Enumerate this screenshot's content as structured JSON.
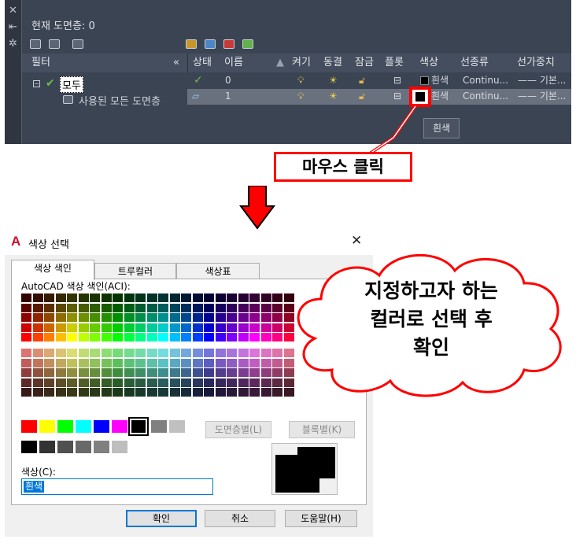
{
  "layer_manager": {
    "side_icons": [
      "✕",
      "⇤",
      "✲"
    ],
    "current_layer": "현재 도면층: 0",
    "filter_header": "필터",
    "collapse_glyph": "«",
    "columns": [
      "상태",
      "이름",
      "켜기",
      "동결",
      "잠금",
      "플롯",
      "색상",
      "선종류",
      "선가중치"
    ],
    "tree": {
      "root": "모두",
      "child": "사용된 모든 도면층"
    },
    "rows": [
      {
        "name": "0",
        "color": "흰색",
        "linetype": "Continu...",
        "lineweight": "—— 기본..."
      },
      {
        "name": "1",
        "color": "흰색",
        "linetype": "Continu...",
        "lineweight": "—— 기본..."
      }
    ],
    "tooltip": "흰색"
  },
  "callout_click": "마우스 클릭",
  "dialog": {
    "title": "색상 선택",
    "close_glyph": "✕",
    "tabs": [
      "색상 색인",
      "트루컬러",
      "색상표"
    ],
    "aci_label": "AutoCAD 색상 색인(ACI):",
    "bylayer_label": "도면층별(L)",
    "byblock_label": "블록별(K)",
    "color_label": "색상(C):",
    "color_value": "흰색",
    "ok_label": "확인",
    "cancel_label": "취소",
    "help_label": "도움말(H)"
  },
  "cloud_text": [
    "지정하고자 하는",
    "컬러로 선택 후",
    "확인"
  ],
  "colors": {
    "accent_red": "#ff0000",
    "highlight": "#0078d7"
  }
}
